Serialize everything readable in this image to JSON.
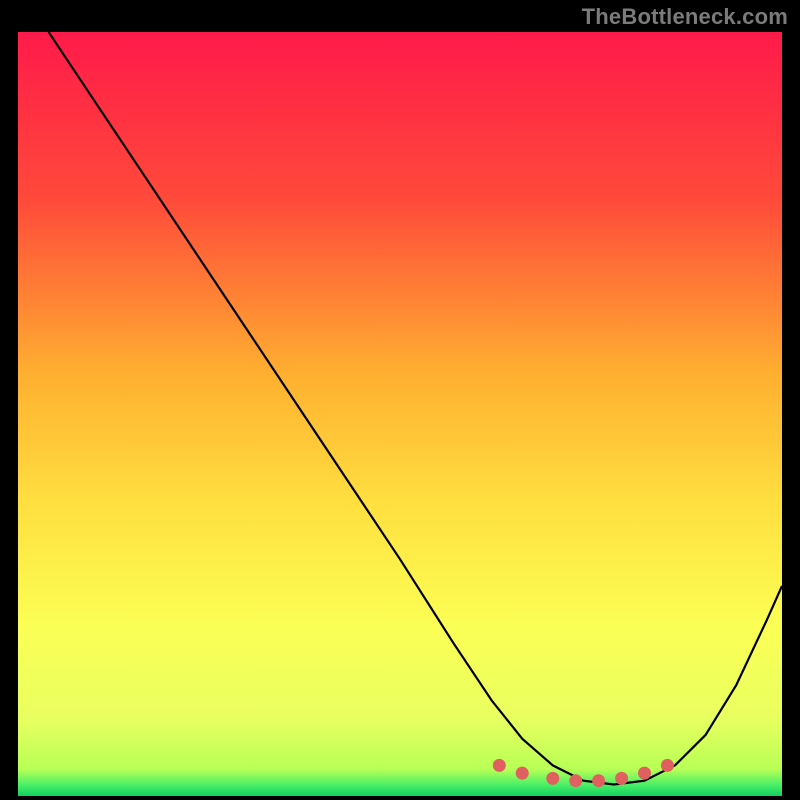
{
  "watermark": "TheBottleneck.com",
  "chart_data": {
    "type": "line",
    "title": "",
    "xlabel": "",
    "ylabel": "",
    "xlim": [
      0,
      100
    ],
    "ylim": [
      0,
      100
    ],
    "grid": false,
    "legend": false,
    "series": [
      {
        "name": "curve",
        "x": [
          4,
          10,
          20,
          30,
          40,
          50,
          57,
          62,
          66,
          70,
          74,
          78,
          82,
          86,
          90,
          94,
          98,
          100
        ],
        "values": [
          100,
          91,
          76,
          61,
          46,
          31,
          20,
          12.5,
          7.5,
          4,
          2,
          1.5,
          2,
          4,
          8,
          14.5,
          23,
          27.5
        ]
      }
    ],
    "markers": {
      "name": "dots",
      "color": "#e06060",
      "x": [
        63,
        66,
        70,
        73,
        76,
        79,
        82,
        85
      ],
      "values": [
        4.0,
        3.0,
        2.3,
        2.0,
        2.0,
        2.3,
        3.0,
        4.0
      ]
    },
    "gradient_stops": [
      {
        "offset": 0.0,
        "color": "#ff1a4a"
      },
      {
        "offset": 0.22,
        "color": "#ff4a3a"
      },
      {
        "offset": 0.45,
        "color": "#ffb030"
      },
      {
        "offset": 0.62,
        "color": "#ffe040"
      },
      {
        "offset": 0.78,
        "color": "#fbff55"
      },
      {
        "offset": 0.9,
        "color": "#e8ff60"
      },
      {
        "offset": 0.965,
        "color": "#b8ff55"
      },
      {
        "offset": 0.985,
        "color": "#4cf068"
      },
      {
        "offset": 1.0,
        "color": "#10d060"
      }
    ]
  }
}
